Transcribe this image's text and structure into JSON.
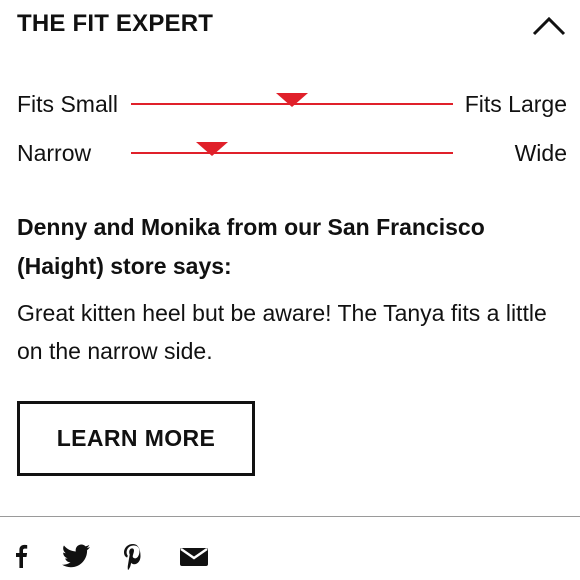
{
  "header": {
    "title": "THE FIT EXPERT"
  },
  "fit_scales": [
    {
      "left_label": "Fits Small",
      "right_label": "Fits Large",
      "value": 0.5
    },
    {
      "left_label": "Narrow",
      "right_label": "Wide",
      "value": 0.25
    }
  ],
  "quote": {
    "heading": "Denny and Monika from our San Francisco (Haight) store says:",
    "body": "Great kitten heel but be aware! The Tanya fits a little on the narrow side."
  },
  "cta": {
    "label": "LEARN MORE"
  },
  "share": {
    "icons": [
      "facebook-icon",
      "twitter-icon",
      "pinterest-icon",
      "email-icon"
    ]
  },
  "colors": {
    "accent": "#e0202a",
    "text": "#111111",
    "divider": "#9a9a9a"
  }
}
